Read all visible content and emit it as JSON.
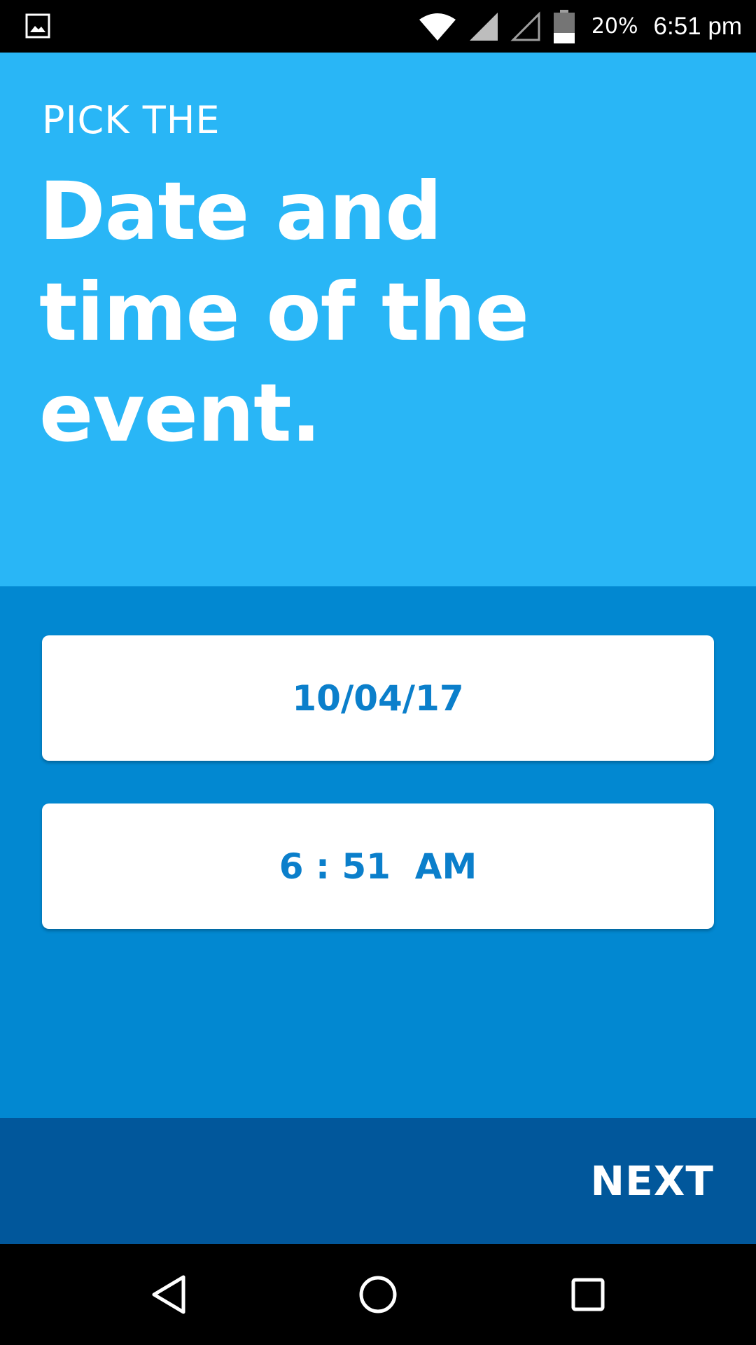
{
  "status_bar": {
    "notification_icon": "image-icon",
    "wifi_icon": "wifi-icon",
    "signal_icon_1": "signal-full-icon",
    "signal_icon_2": "signal-empty-icon",
    "battery_icon": "battery-icon",
    "battery_percent": "20%",
    "time": "6:51 pm"
  },
  "header": {
    "kicker": "PICK THE",
    "title_line_1": "Date and",
    "title_line_2": "time of the",
    "title_line_3": "event."
  },
  "pickers": {
    "date_value": "10/04/17",
    "time_value": "6 : 51  AM"
  },
  "footer": {
    "next_label": "NEXT"
  },
  "nav_bar": {
    "back_icon": "back-triangle-icon",
    "home_icon": "home-circle-icon",
    "recents_icon": "recents-square-icon"
  },
  "colors": {
    "header_bg": "#29b6f6",
    "main_bg": "#0288d1",
    "footer_bg": "#01579b",
    "picker_text": "#0b7fcb"
  }
}
